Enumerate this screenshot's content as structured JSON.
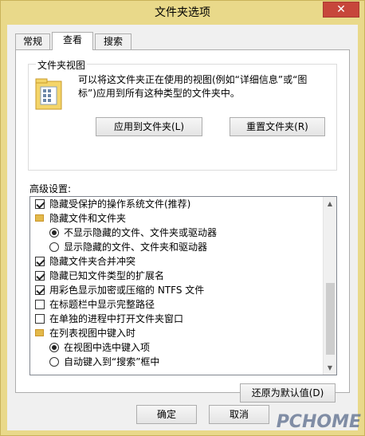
{
  "window": {
    "title": "文件夹选项",
    "close_glyph": "✕"
  },
  "tabs": [
    {
      "label": "常规",
      "active": false
    },
    {
      "label": "查看",
      "active": true
    },
    {
      "label": "搜索",
      "active": false
    }
  ],
  "folder_views": {
    "legend": "文件夹视图",
    "icon": "folder-view-icon",
    "description": "可以将这文件夹正在使用的视图(例如“详细信息”或“图标”)应用到所有这种类型的文件夹中。",
    "apply_button": "应用到文件夹(L)",
    "reset_button": "重置文件夹(R)"
  },
  "advanced": {
    "label": "高级设置:",
    "items": [
      {
        "kind": "checkbox",
        "checked": true,
        "indent": 0,
        "label": "隐藏受保护的操作系统文件(推荐)"
      },
      {
        "kind": "folder",
        "indent": 0,
        "label": "隐藏文件和文件夹"
      },
      {
        "kind": "radio",
        "checked": true,
        "indent": 1,
        "label": "不显示隐藏的文件、文件夹或驱动器"
      },
      {
        "kind": "radio",
        "checked": false,
        "indent": 1,
        "label": "显示隐藏的文件、文件夹和驱动器"
      },
      {
        "kind": "checkbox",
        "checked": true,
        "indent": 0,
        "label": "隐藏文件夹合并冲突"
      },
      {
        "kind": "checkbox",
        "checked": true,
        "indent": 0,
        "label": "隐藏已知文件类型的扩展名"
      },
      {
        "kind": "checkbox",
        "checked": true,
        "indent": 0,
        "label": "用彩色显示加密或压缩的 NTFS 文件"
      },
      {
        "kind": "checkbox",
        "checked": false,
        "indent": 0,
        "label": "在标题栏中显示完整路径"
      },
      {
        "kind": "checkbox",
        "checked": false,
        "indent": 0,
        "label": "在单独的进程中打开文件夹窗口"
      },
      {
        "kind": "folder",
        "indent": 0,
        "label": "在列表视图中键入时"
      },
      {
        "kind": "radio",
        "checked": true,
        "indent": 1,
        "label": "在视图中选中键入项"
      },
      {
        "kind": "radio",
        "checked": false,
        "indent": 1,
        "label": "自动键入到“搜索”框中"
      }
    ],
    "scroll_up": "▲",
    "scroll_down": "▼",
    "restore_defaults": "还原为默认值(D)"
  },
  "footer": {
    "ok": "确定",
    "cancel": "取消"
  },
  "watermark": "PCHOME"
}
